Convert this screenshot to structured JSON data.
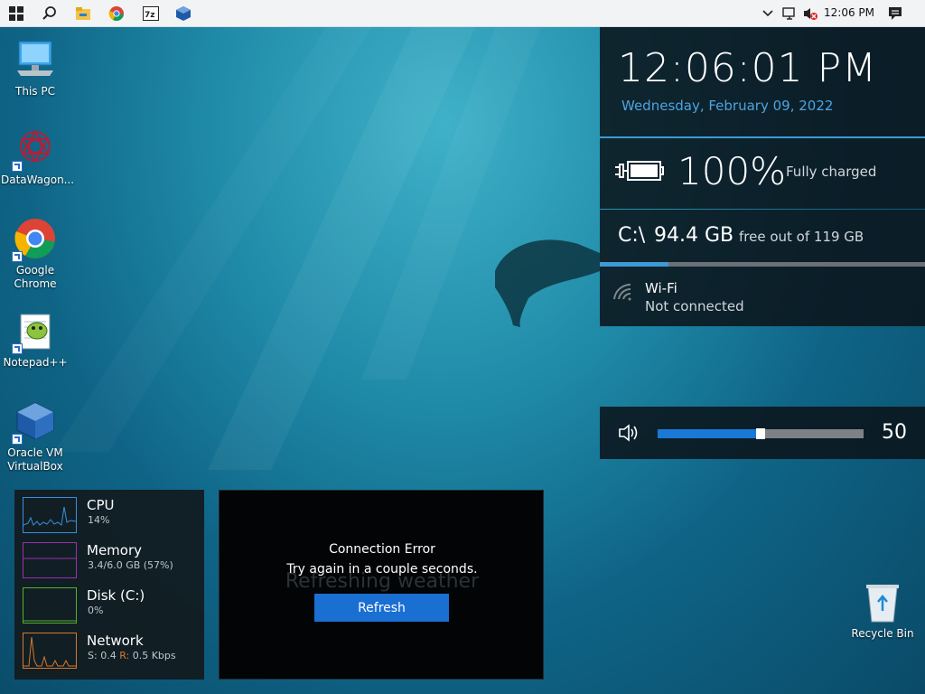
{
  "taskbar": {
    "items": [
      "start-icon",
      "search-icon",
      "file-explorer-icon",
      "chrome-icon",
      "7zip-icon",
      "virtualbox-icon"
    ],
    "tray": {
      "time": "12:06 PM"
    }
  },
  "desktop": {
    "icons": [
      {
        "label": "This PC"
      },
      {
        "label": "DataWagon..."
      },
      {
        "label": "Google Chrome"
      },
      {
        "label": "Notepad++"
      },
      {
        "label": "Oracle VM VirtualBox"
      },
      {
        "label": "Recycle Bin"
      }
    ]
  },
  "clock": {
    "time": "12:06:01 PM",
    "date": "Wednesday, February 09, 2022"
  },
  "battery": {
    "percent": "100%",
    "status": "Fully charged"
  },
  "disk": {
    "drive": "C:\\",
    "free": "94.4 GB",
    "note": "free out of 119 GB",
    "used_fraction": 0.21
  },
  "wifi": {
    "title": "Wi-Fi",
    "status": "Not connected"
  },
  "volume": {
    "value": "50",
    "level_fraction": 0.5
  },
  "perf": {
    "rows": [
      {
        "name": "CPU",
        "value": "14%",
        "color": "#3a8fd8"
      },
      {
        "name": "Memory",
        "value": "3.4/6.0 GB (57%)",
        "color": "#9b2fae"
      },
      {
        "name": "Disk (C:)",
        "value": "0%",
        "color": "#55b02e"
      },
      {
        "name": "Network",
        "value_send_label": "S:",
        "value_send": "0.4",
        "value_recv_label": "R:",
        "value_recv": "0.5 Kbps",
        "color": "#d8782a"
      }
    ]
  },
  "error_widget": {
    "ghost_text": "Refreshing weather",
    "title": "Connection Error",
    "message": "Try again in a couple seconds.",
    "button": "Refresh"
  },
  "colors": {
    "accent": "#1a6fd3",
    "date_blue": "#4da3e0"
  }
}
